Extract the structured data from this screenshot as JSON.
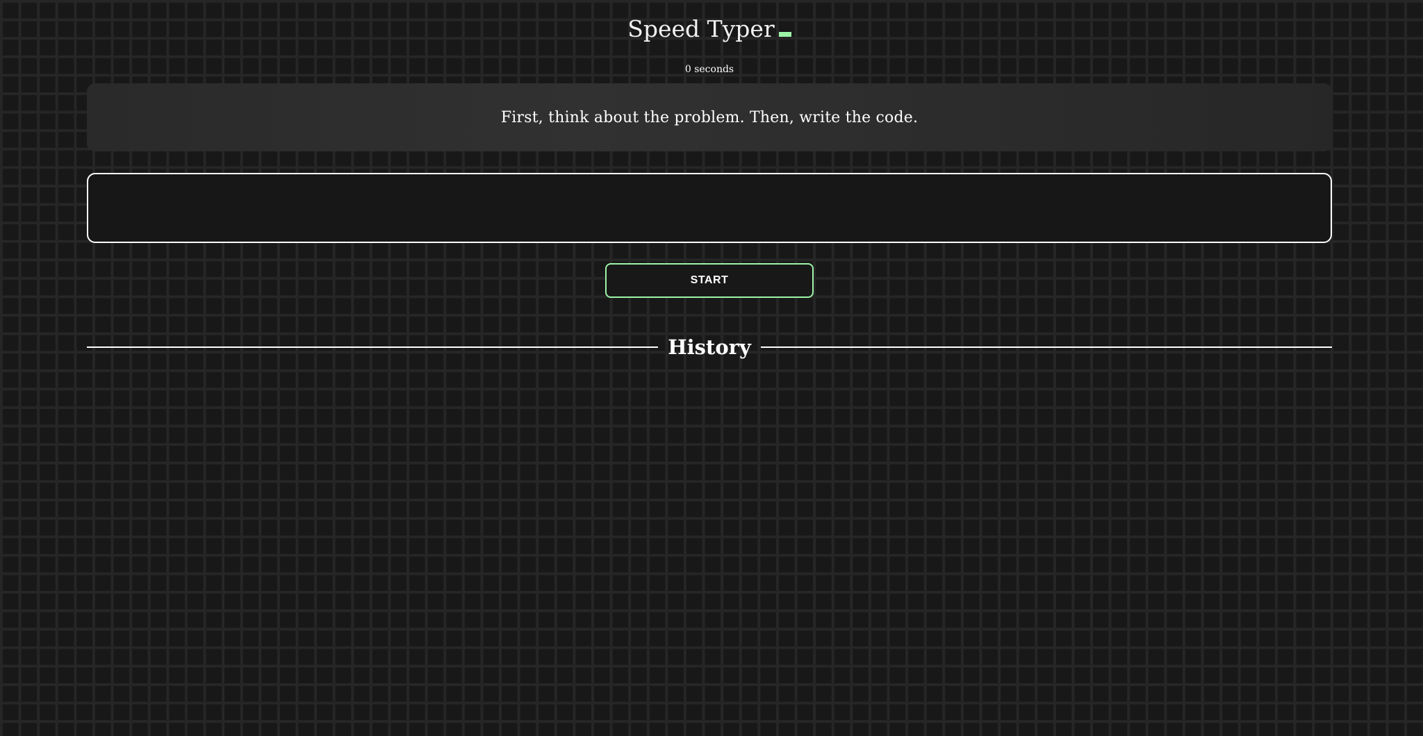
{
  "header": {
    "title": "Speed Typer",
    "cursor_color": "#9ef5a8"
  },
  "timer": {
    "label": "0 seconds"
  },
  "prompt": {
    "text": "First, think about the problem. Then, write the code."
  },
  "typing_input": {
    "value": "",
    "placeholder": ""
  },
  "controls": {
    "start_label": "START",
    "accent_color": "#9ef5a8"
  },
  "history": {
    "title": "History"
  }
}
